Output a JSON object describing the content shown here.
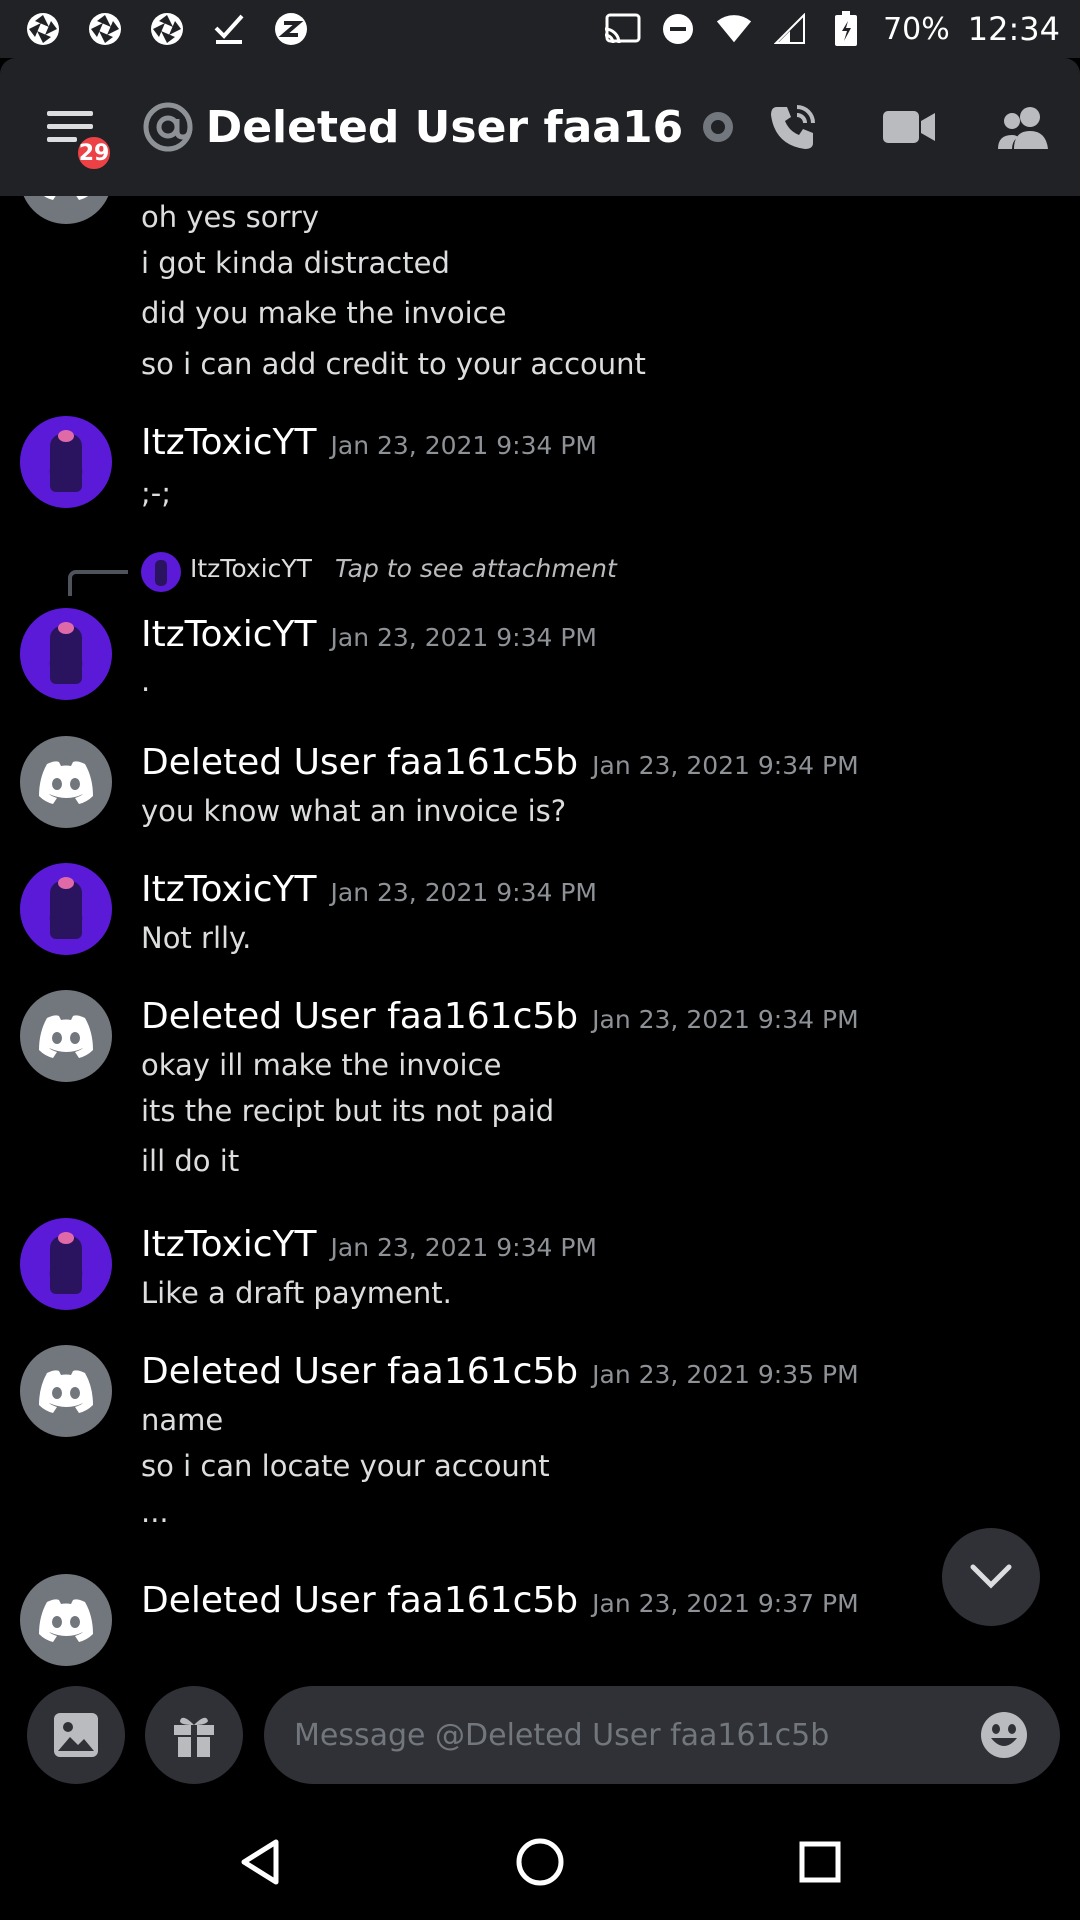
{
  "status_bar": {
    "battery": "70%",
    "time": "12:34"
  },
  "header": {
    "badge": "29",
    "title": "Deleted User faa161c..."
  },
  "messages": [
    {
      "lines": [
        "oh yes sorry",
        "i got kinda distracted",
        "did you make the invoice",
        "so i can add credit to your account"
      ]
    },
    {
      "author": "ItzToxicYT",
      "time": "Jan 23, 2021 9:34 PM",
      "lines": [
        ";-;"
      ]
    },
    {
      "reply": {
        "author": "ItzToxicYT",
        "text": "Tap to see attachment"
      },
      "author": "ItzToxicYT",
      "time": "Jan 23, 2021 9:34 PM",
      "lines": [
        "."
      ]
    },
    {
      "author": "Deleted User faa161c5b",
      "time": "Jan 23, 2021 9:34 PM",
      "lines": [
        "you know what an invoice is?"
      ]
    },
    {
      "author": "ItzToxicYT",
      "time": "Jan 23, 2021 9:34 PM",
      "lines": [
        "Not rlly."
      ]
    },
    {
      "author": "Deleted User faa161c5b",
      "time": "Jan 23, 2021 9:34 PM",
      "lines": [
        "okay ill make the invoice",
        "its the recipt but its not paid",
        "ill do it"
      ]
    },
    {
      "author": "ItzToxicYT",
      "time": "Jan 23, 2021 9:34 PM",
      "lines": [
        "Like a draft payment."
      ]
    },
    {
      "author": "Deleted User faa161c5b",
      "time": "Jan 23, 2021 9:35 PM",
      "lines": [
        "name",
        "so i can locate your account",
        "..."
      ]
    },
    {
      "author": "Deleted User faa161c5b",
      "time": "Jan 23, 2021 9:37 PM",
      "lines": []
    }
  ],
  "composer": {
    "placeholder": "Message @Deleted User faa161c5b"
  }
}
